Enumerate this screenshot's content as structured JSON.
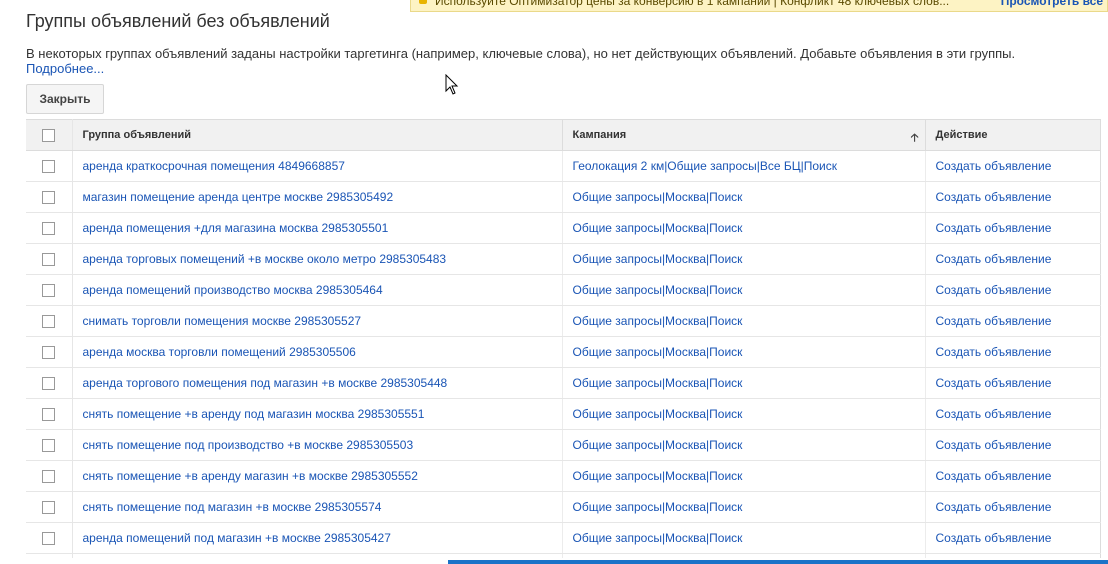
{
  "notification": {
    "message": "Используйте Оптимизатор цены за конверсию в 1 кампании  |  Конфликт 48 ключевых слов...",
    "view_label": "Просмотреть все"
  },
  "page": {
    "title": "Группы объявлений без объявлений",
    "description": "В некоторых группах объявлений заданы настройки таргетинга (например, ключевые слова), но нет действующих объявлений. Добавьте объявления в эти группы.",
    "more_link": "Подробнее...",
    "close_button": "Закрыть"
  },
  "table": {
    "headers": {
      "group": "Группа объявлений",
      "campaign": "Кампания",
      "action": "Действие"
    },
    "sort_icon": "arrow-up-icon",
    "rows": [
      {
        "group": "аренда краткосрочная помещения 4849668857",
        "campaign": "Геолокация 2 км|Общие запросы|Все БЦ|Поиск",
        "action": "Создать объявление"
      },
      {
        "group": "магазин помещение аренда центре москве 2985305492",
        "campaign": "Общие запросы|Москва|Поиск",
        "action": "Создать объявление"
      },
      {
        "group": "аренда помещения +для магазина москва 2985305501",
        "campaign": "Общие запросы|Москва|Поиск",
        "action": "Создать объявление"
      },
      {
        "group": "аренда торговых помещений +в москве около метро 2985305483",
        "campaign": "Общие запросы|Москва|Поиск",
        "action": "Создать объявление"
      },
      {
        "group": "аренда помещений производство москва 2985305464",
        "campaign": "Общие запросы|Москва|Поиск",
        "action": "Создать объявление"
      },
      {
        "group": "снимать торговли помещения москве 2985305527",
        "campaign": "Общие запросы|Москва|Поиск",
        "action": "Создать объявление"
      },
      {
        "group": "аренда москва торговли помещений 2985305506",
        "campaign": "Общие запросы|Москва|Поиск",
        "action": "Создать объявление"
      },
      {
        "group": "аренда торгового помещения под магазин +в москве 2985305448",
        "campaign": "Общие запросы|Москва|Поиск",
        "action": "Создать объявление"
      },
      {
        "group": "снять помещение +в аренду под магазин москва 2985305551",
        "campaign": "Общие запросы|Москва|Поиск",
        "action": "Создать объявление"
      },
      {
        "group": "снять помещение под производство +в москве 2985305503",
        "campaign": "Общие запросы|Москва|Поиск",
        "action": "Создать объявление"
      },
      {
        "group": "снять помещение +в аренду магазин +в москве 2985305552",
        "campaign": "Общие запросы|Москва|Поиск",
        "action": "Создать объявление"
      },
      {
        "group": "снять помещение под магазин +в москве 2985305574",
        "campaign": "Общие запросы|Москва|Поиск",
        "action": "Создать объявление"
      },
      {
        "group": "аренда помещений под магазин +в москве 2985305427",
        "campaign": "Общие запросы|Москва|Поиск",
        "action": "Создать объявление"
      }
    ]
  },
  "colors": {
    "link": "#1a55b5",
    "header_bg": "#f1f1f1",
    "notification_bg": "#fdf3c4",
    "progress": "#1a73c8"
  }
}
